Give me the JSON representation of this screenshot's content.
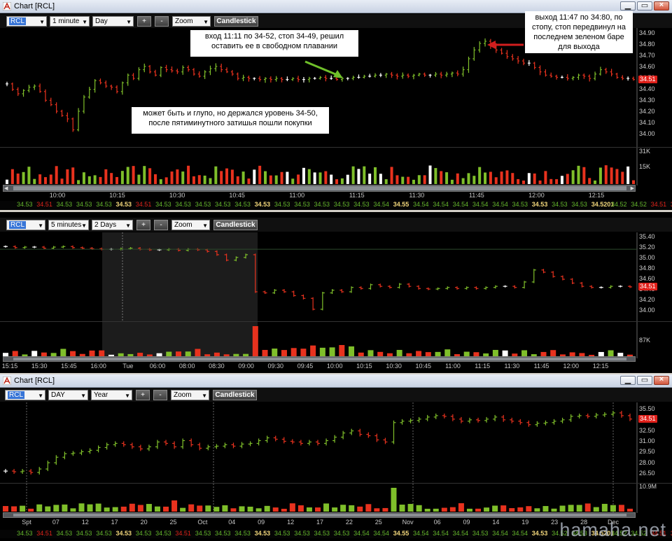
{
  "windows": [
    {
      "title": "Chart [RCL]",
      "symbol": "RCL",
      "interval": "1 minute",
      "range": "Day",
      "zoom": "Zoom",
      "style": "Candlestick",
      "plus": "+",
      "minus": "-",
      "price_labels": [
        "34.90",
        "34.80",
        "34.70",
        "34.60",
        "34.50",
        "34.40",
        "34.30",
        "34.20",
        "34.10",
        "34.00"
      ],
      "last_price": "34.51",
      "volume_labels": [
        "31K",
        "15K"
      ],
      "time_labels": [
        "10:00",
        "10:15",
        "10:30",
        "10:45",
        "11:00",
        "11:15",
        "11:30",
        "11:45",
        "12:00",
        "12:15"
      ],
      "notes": {
        "entry": "вход 11:11 по 34-52, стоп 34-49, решил оставить ее в свободном плавании",
        "exit": "выход 11:47 по 34:80, по стопу, стоп передвинул на последнем зеленом баре для выхода",
        "level": "может быть и глупо, но держался уровень 34-50, после пятиминутного затишья пошли покупки"
      }
    },
    {
      "symbol": "RCL",
      "interval": "5 minutes",
      "range": "2 Days",
      "zoom": "Zoom",
      "style": "Candlestick",
      "plus": "+",
      "minus": "-",
      "price_labels": [
        "35.40",
        "35.20",
        "35.00",
        "34.80",
        "34.60",
        "34.40",
        "34.20",
        "34.00"
      ],
      "last_price": "34.51",
      "volume_labels": [
        "87K"
      ],
      "time_labels": [
        "15:15",
        "15:30",
        "15:45",
        "16:00",
        "Tue",
        "06:00",
        "08:00",
        "08:30",
        "09:00",
        "09:30",
        "09:45",
        "10:00",
        "10:15",
        "10:30",
        "10:45",
        "11:00",
        "11:15",
        "11:30",
        "11:45",
        "12:00",
        "12:15"
      ]
    },
    {
      "title": "Chart [RCL]",
      "symbol": "RCL",
      "interval": "DAY",
      "range": "Year",
      "zoom": "Zoom",
      "style": "Candlestick",
      "plus": "+",
      "minus": "-",
      "price_labels": [
        "35.50",
        "34.00",
        "32.50",
        "31.00",
        "29.50",
        "28.00",
        "26.50"
      ],
      "last_price": "34.51",
      "volume_labels": [
        "10.9M"
      ],
      "time_labels": [
        "Spt",
        "07",
        "12",
        "17",
        "20",
        "25",
        "Oct",
        "04",
        "09",
        "12",
        "17",
        "22",
        "25",
        "Nov",
        "06",
        "09",
        "14",
        "19",
        "23",
        "28",
        "Dec"
      ]
    }
  ],
  "quote_strip_1": [
    "34.53",
    "34.51",
    "34.53",
    "34.53",
    "34.53",
    "34.53",
    "34.51",
    "34.53",
    "34.53",
    "34.53",
    "34.53",
    "34.53",
    "34.53",
    "34.53",
    "34.53",
    "34.53",
    "34.53",
    "34.53",
    "34.54",
    "34.55",
    "34.54",
    "34.54",
    "34.54",
    "34.54",
    "34.54",
    "34.53",
    "34.53",
    "34.53",
    "34.53",
    "34.5201",
    "34.52",
    "34.52",
    "34.51",
    "34.51"
  ],
  "quote_strip_3": [
    "34.53",
    "34.51",
    "34.53",
    "34.53",
    "34.53",
    "34.53",
    "34.53",
    "34.53",
    "34.51",
    "34.53",
    "34.53",
    "34.53",
    "34.53",
    "34.53",
    "34.53",
    "34.53",
    "34.53",
    "34.54",
    "34.54",
    "34.55",
    "34.54",
    "34.54",
    "34.54",
    "34.53",
    "34.54",
    "34.54",
    "34.53",
    "34.52",
    "34.53",
    "34.5201",
    "34.52",
    "34.52",
    "34.51",
    "34.51"
  ],
  "watermark": "hamaha.net",
  "colors": {
    "up": "#7fbf2a",
    "down": "#e8321e",
    "neutral": "#ffffff",
    "badge": "#e0201a"
  }
}
